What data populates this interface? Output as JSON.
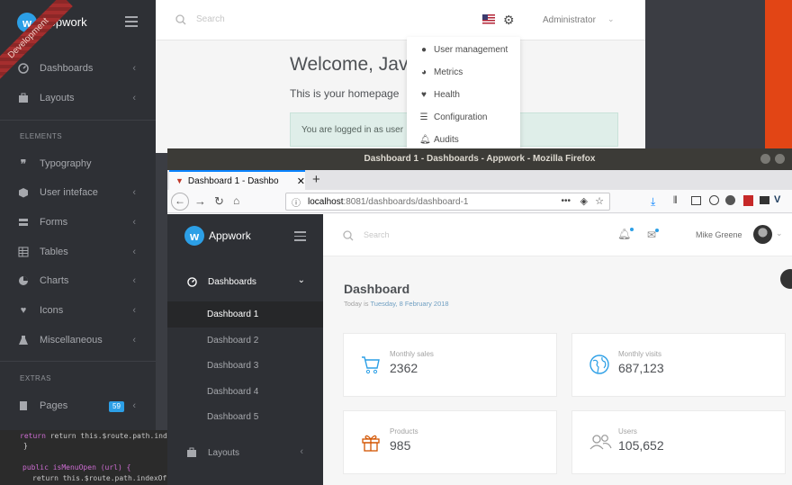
{
  "back_window": {
    "brand": "Appwork",
    "ribbon": "Development",
    "search_placeholder": "Search",
    "user": "Administrator",
    "welcome": "Welcome, Jav",
    "subtitle": "This is your homepage",
    "alert": "You are logged in as user",
    "sidebar": {
      "items_top": [
        {
          "label": "Dashboards",
          "icon": "speedometer-icon"
        },
        {
          "label": "Layouts",
          "icon": "layers-icon"
        }
      ],
      "section_elements": "ELEMENTS",
      "items_elements": [
        {
          "label": "Typography",
          "icon": "quote-icon"
        },
        {
          "label": "User inteface",
          "icon": "cube-icon"
        },
        {
          "label": "Forms",
          "icon": "forms-icon"
        },
        {
          "label": "Tables",
          "icon": "table-icon"
        },
        {
          "label": "Charts",
          "icon": "pie-chart-icon"
        },
        {
          "label": "Icons",
          "icon": "heart-icon"
        },
        {
          "label": "Miscellaneous",
          "icon": "flask-icon"
        }
      ],
      "section_extras": "EXTRAS",
      "pages_label": "Pages",
      "pages_badge": "59"
    },
    "dropdown": [
      "User management",
      "Metrics",
      "Health",
      "Configuration",
      "Audits"
    ],
    "code": [
      "return this.$route.path.indexOf",
      "}",
      "",
      "public isMenuOpen (url) {",
      "return this.$route.path.indexOf"
    ]
  },
  "firefox": {
    "title": "Dashboard 1 - Dashboards - Appwork - Mozilla Firefox",
    "tab_label": "Dashboard 1 - Dashbo",
    "url_host": "localhost",
    "url_rest": ":8081/dashboards/dashboard-1"
  },
  "app": {
    "brand": "Appwork",
    "search_placeholder": "Search",
    "user": "Mike Greene",
    "nav": {
      "dashboards": "Dashboards",
      "sub": [
        "Dashboard 1",
        "Dashboard 2",
        "Dashboard 3",
        "Dashboard 4",
        "Dashboard 5"
      ],
      "layouts": "Layouts"
    },
    "page_title": "Dashboard",
    "date_prefix": "Today is ",
    "date": "Tuesday, 8 February 2018",
    "cards": [
      {
        "label": "Monthly sales",
        "value": "2362",
        "icon": "cart-icon"
      },
      {
        "label": "Monthly visits",
        "value": "687,123",
        "icon": "globe-icon"
      },
      {
        "label": "Products",
        "value": "985",
        "icon": "gift-icon"
      },
      {
        "label": "Users",
        "value": "105,652",
        "icon": "users-icon"
      }
    ],
    "colors": {
      "accent": "#2c9fe6",
      "sidebar": "#2e3035"
    }
  }
}
